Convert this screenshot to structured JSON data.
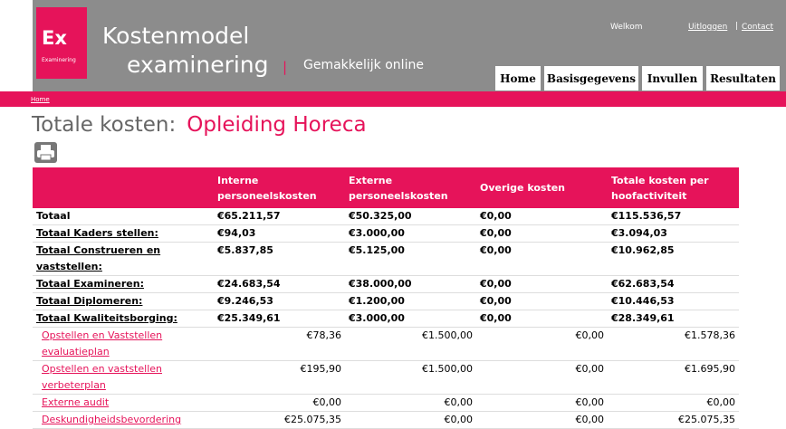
{
  "logo": {
    "text": "Ex",
    "subtext": "Examinering"
  },
  "header": {
    "title_line1": "Kostenmodel",
    "title_line2": "examinering",
    "separator": "|",
    "tagline": "Gemakkelijk online",
    "welcome": "Welkom",
    "logout_link": "Uitloggen",
    "link_separator": "|",
    "contact_link": "Contact"
  },
  "nav": [
    {
      "label": "Home"
    },
    {
      "label": "Basisgegevens"
    },
    {
      "label": "Invullen"
    },
    {
      "label": "Resultaten"
    }
  ],
  "breadcrumb": "Home",
  "page": {
    "title": "Totale kosten:",
    "subtitle": "Opleiding Horeca",
    "print_icon": "print-icon"
  },
  "table": {
    "headers": [
      "",
      "Interne personeelskosten",
      "Externe personeelskosten",
      "Overige kosten",
      "Totale kosten per hoofactiviteit"
    ],
    "total_rows": [
      {
        "label": "Totaal",
        "interne": "€65.211,57",
        "externe": "€50.325,00",
        "overige": "€0,00",
        "totaal": "€115.536,57"
      },
      {
        "label": "Totaal Kaders stellen:",
        "interne": "€94,03",
        "externe": "€3.000,00",
        "overige": "€0,00",
        "totaal": "€3.094,03"
      },
      {
        "label": "Totaal Construeren en vaststellen:",
        "interne": "€5.837,85",
        "externe": "€5.125,00",
        "overige": "€0,00",
        "totaal": "€10.962,85"
      },
      {
        "label": "Totaal Examineren:",
        "interne": "€24.683,54",
        "externe": "€38.000,00",
        "overige": "€0,00",
        "totaal": "€62.683,54"
      },
      {
        "label": "Totaal Diplomeren:",
        "interne": "€9.246,53",
        "externe": "€1.200,00",
        "overige": "€0,00",
        "totaal": "€10.446,53"
      },
      {
        "label": "Totaal Kwaliteitsborging:",
        "interne": "€25.349,61",
        "externe": "€3.000,00",
        "overige": "€0,00",
        "totaal": "€28.349,61"
      }
    ],
    "detail_rows": [
      {
        "label": "Opstellen en Vaststellen evaluatieplan",
        "interne": "€78,36",
        "externe": "€1.500,00",
        "overige": "€0,00",
        "totaal": "€1.578,36"
      },
      {
        "label": "Opstellen en vaststellen verbeterplan",
        "interne": "€195,90",
        "externe": "€1.500,00",
        "overige": "€0,00",
        "totaal": "€1.695,90"
      },
      {
        "label": "Externe audit",
        "interne": "€0,00",
        "externe": "€0,00",
        "overige": "€0,00",
        "totaal": "€0,00"
      },
      {
        "label": "Deskundigheidsbevordering",
        "interne": "€25.075,35",
        "externe": "€0,00",
        "overige": "€0,00",
        "totaal": "€25.075,35"
      }
    ]
  },
  "colors": {
    "accent": "#e6135a",
    "header_bg": "#8c8c8c"
  }
}
